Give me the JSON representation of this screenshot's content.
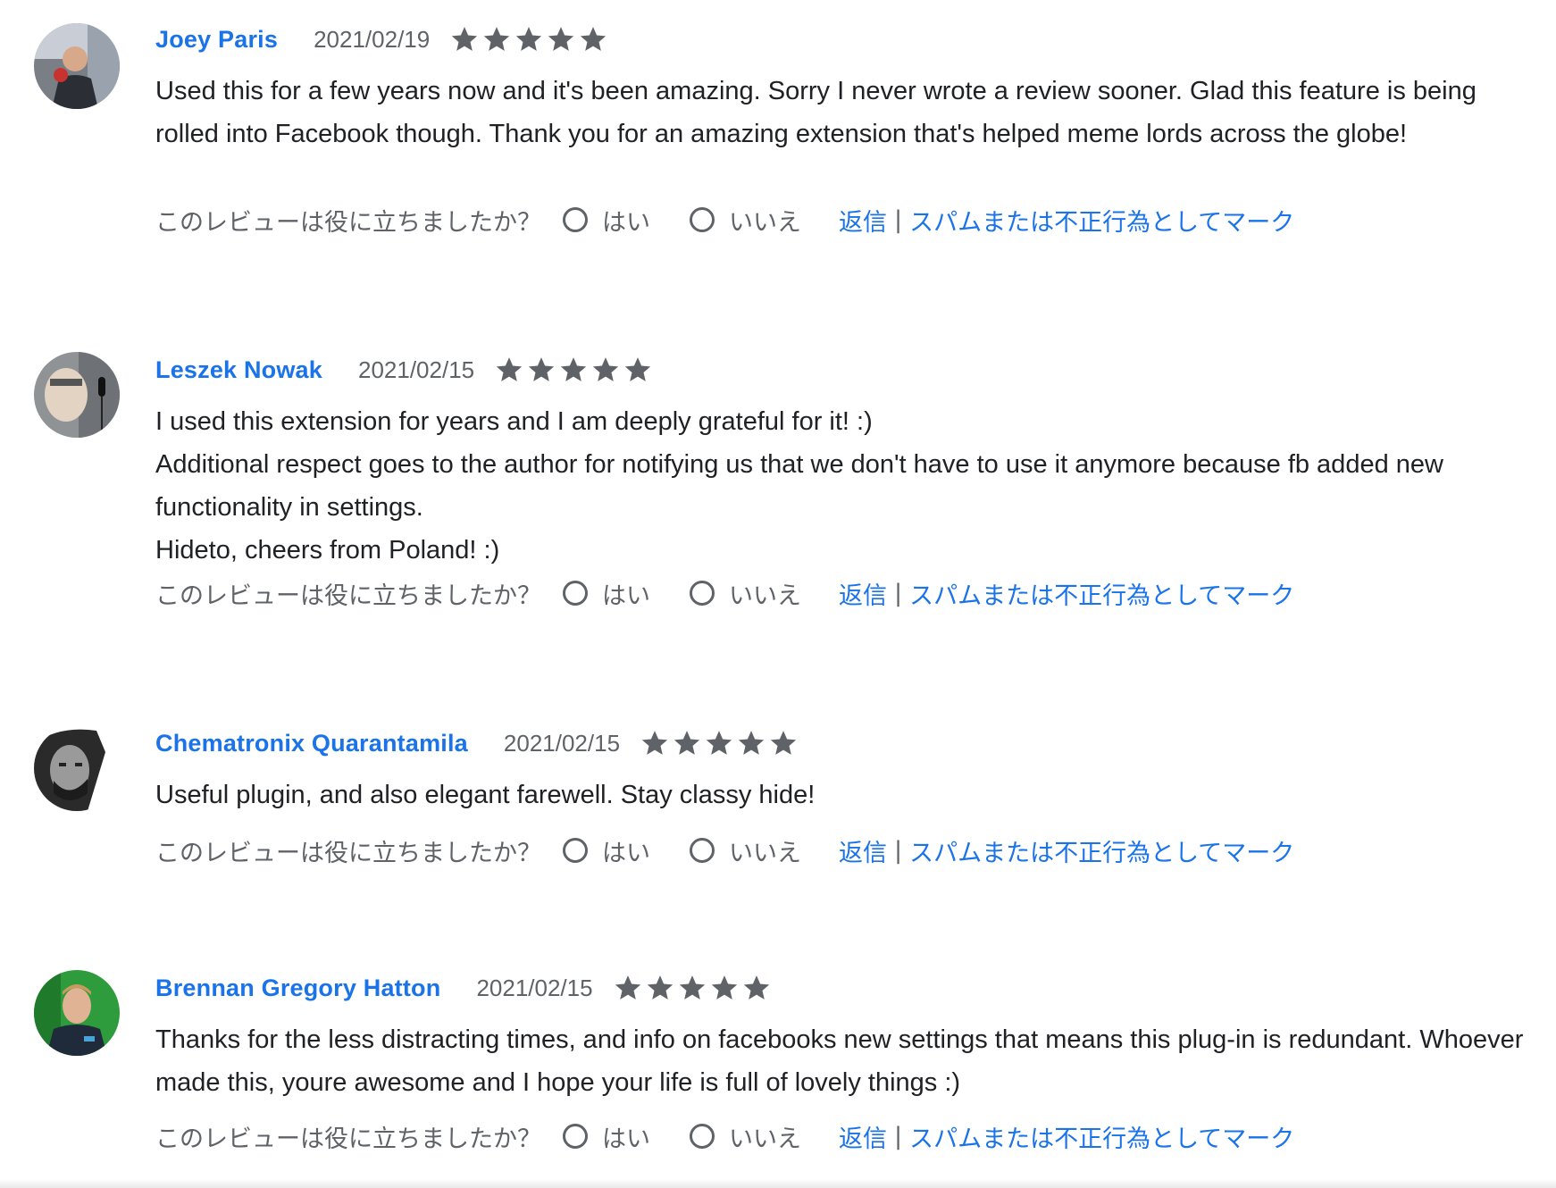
{
  "reviews": [
    {
      "author": "Joey Paris",
      "date": "2021/02/19",
      "rating": 5,
      "text": [
        "Used this for a few years now and it's been amazing. Sorry I never wrote a review sooner. Glad this feature is being rolled into Facebook though. Thank you for an amazing extension that's helped meme lords across the globe!"
      ]
    },
    {
      "author": "Leszek Nowak",
      "date": "2021/02/15",
      "rating": 5,
      "text": [
        "I used this extension for years and I am deeply grateful for it! :)",
        "Additional respect goes to the author for notifying us that we don't have to use it anymore because fb added new functionality in settings.",
        "Hideto, cheers from Poland! :)"
      ]
    },
    {
      "author": "Chematronix Quarantamila",
      "date": "2021/02/15",
      "rating": 5,
      "text": [
        "Useful plugin, and also elegant farewell.  Stay classy hide!"
      ]
    },
    {
      "author": "Brennan Gregory Hatton",
      "date": "2021/02/15",
      "rating": 5,
      "text": [
        "Thanks for the less distracting times, and info on facebooks new settings that means this plug-in is redundant. Whoever made this, youre awesome and I hope your life is full of lovely things :)"
      ]
    }
  ],
  "labels": {
    "helpful_question": "このレビューは役に立ちましたか？",
    "yes": "はい",
    "no": "いいえ",
    "reply": "返信",
    "separator": "|",
    "report": "スパムまたは不正行為としてマーク"
  },
  "colors": {
    "link": "#1a73e8",
    "star": "#5f6368",
    "muted": "#5f6368"
  },
  "icons": {
    "star": "star-icon",
    "radio": "radio-unchecked-icon"
  }
}
